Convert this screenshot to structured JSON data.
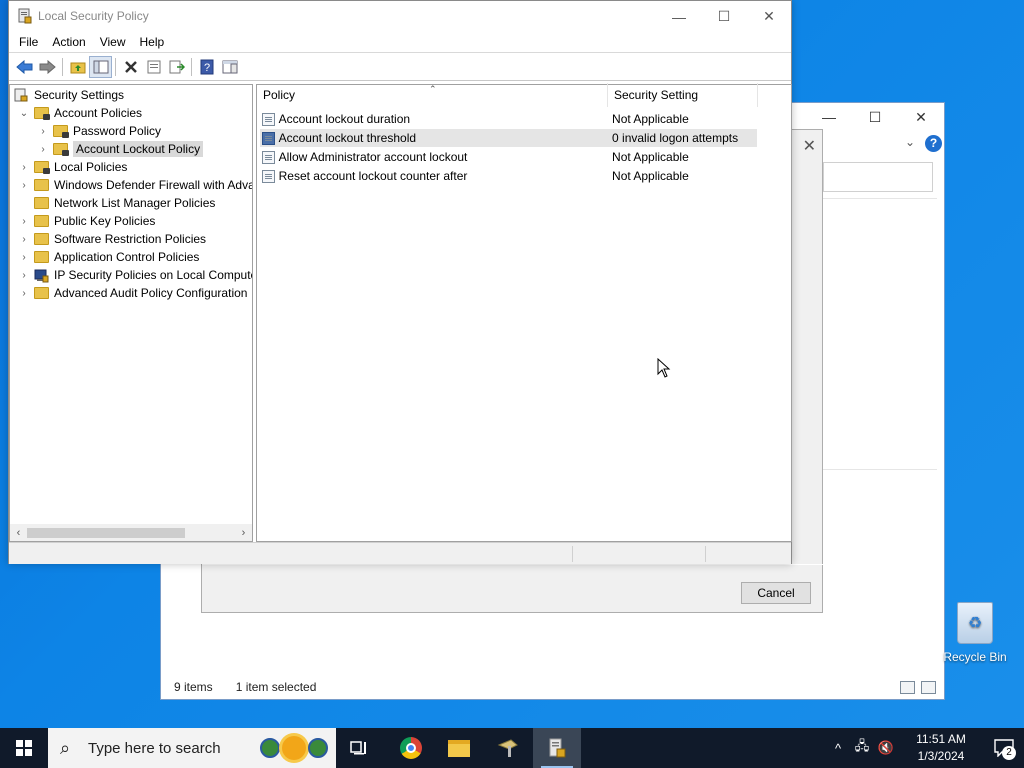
{
  "window": {
    "title": "Local Security Policy",
    "minimize": "—",
    "maximize": "☐",
    "close": "✕"
  },
  "menu": {
    "items": [
      "File",
      "Action",
      "View",
      "Help"
    ]
  },
  "toolbar": {
    "icons": [
      "back-icon",
      "forward-icon",
      "up-folder-icon",
      "show-hide-tree-icon",
      "delete-icon",
      "properties-icon",
      "export-list-icon",
      "help-icon",
      "show-action-pane-icon"
    ]
  },
  "tree": {
    "root": "Security Settings",
    "items": [
      {
        "label": "Account Policies",
        "expanded": true
      },
      {
        "label": "Password Policy"
      },
      {
        "label": "Account Lockout Policy",
        "selected": true
      },
      {
        "label": "Local Policies"
      },
      {
        "label": "Windows Defender Firewall with Adva"
      },
      {
        "label": "Network List Manager Policies"
      },
      {
        "label": "Public Key Policies"
      },
      {
        "label": "Software Restriction Policies"
      },
      {
        "label": "Application Control Policies"
      },
      {
        "label": "IP Security Policies on Local Compute"
      },
      {
        "label": "Advanced Audit Policy Configuration"
      }
    ]
  },
  "list": {
    "columns": [
      "Policy",
      "Security Setting"
    ],
    "rows": [
      {
        "policy": "Account lockout duration",
        "setting": "Not Applicable"
      },
      {
        "policy": "Account lockout threshold",
        "setting": "0 invalid logon attempts",
        "selected": true
      },
      {
        "policy": "Allow Administrator account lockout",
        "setting": "Not Applicable"
      },
      {
        "policy": "Reset account lockout counter after",
        "setting": "Not Applicable"
      }
    ]
  },
  "dialog": {
    "cancel_label": "Cancel"
  },
  "bg_explorer": {
    "items_count": "9 items",
    "selected_count": "1 item selected"
  },
  "desktop": {
    "recycle_bin_label": "Recycle Bin"
  },
  "taskbar": {
    "search_placeholder": "Type here to search",
    "time": "11:51 AM",
    "date": "1/3/2024",
    "notification_count": "2"
  }
}
